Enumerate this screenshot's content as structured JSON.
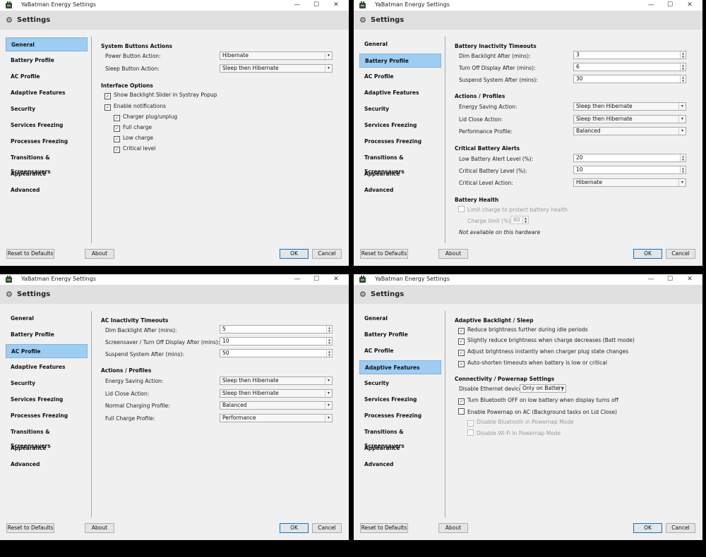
{
  "app_title": "YaBatman Energy Settings",
  "header_title": "Settings",
  "controls": {
    "minimize": "—",
    "maximize": "☐",
    "close": "✕"
  },
  "nav": [
    "General",
    "Battery Profile",
    "AC Profile",
    "Adaptive Features",
    "Security",
    "Services Freezing",
    "Processes Freezing",
    "Transitions & Screensavers",
    "Appearance",
    "Advanced"
  ],
  "buttons": {
    "reset": "Reset to Defaults",
    "about": "About",
    "ok": "OK",
    "cancel": "Cancel"
  },
  "colors": {
    "nav_active": "#9dcdf3",
    "header_bg": "#e0e0e0",
    "window_bg": "#f0f0f0"
  },
  "windows": [
    {
      "active_nav": "General",
      "general": {
        "system_buttons_title": "System Buttons Actions",
        "power_label": "Power Button Action:",
        "power_value": "Hibernate",
        "sleep_label": "Sleep Button Action:",
        "sleep_value": "Sleep then Hibernate",
        "interface_title": "Interface Options",
        "show_backlight": "Show Backlight Slider in Systray Popup",
        "enable_notifications": "Enable notifications",
        "charger_plug": "Charger plug/unplug",
        "full_charge": "Full charge",
        "low_charge": "Low charge",
        "critical_level": "Critical level"
      }
    },
    {
      "active_nav": "Battery Profile",
      "battery": {
        "timeouts_title": "Battery Inactivity Timeouts",
        "dim_label": "Dim Backlight After (mins):",
        "dim_value": "3",
        "off_label": "Turn Off Display After (mins):",
        "off_value": "6",
        "suspend_label": "Suspend System After (mins):",
        "suspend_value": "30",
        "actions_title": "Actions / Profiles",
        "energy_label": "Energy Saving Action:",
        "energy_value": "Sleep then Hibernate",
        "lid_label": "Lid Close Action:",
        "lid_value": "Sleep then Hibernate",
        "perf_label": "Performance Profile:",
        "perf_value": "Balanced",
        "alerts_title": "Critical Battery Alerts",
        "low_alert_label": "Low Battery Alert Level (%):",
        "low_alert_value": "20",
        "critical_label": "Critical Battery Level (%):",
        "critical_value": "10",
        "critical_action_label": "Critical Level Action:",
        "critical_action_value": "Hibernate",
        "health_title": "Battery Health",
        "limit_charge": "Limit charge to protect battery health",
        "charge_limit_label": "Charge limit (%):",
        "charge_limit_value": "60",
        "not_available": "Not available on this hardware"
      }
    },
    {
      "active_nav": "AC Profile",
      "ac": {
        "timeouts_title": "AC Inactivity Timeouts",
        "dim_label": "Dim Backlight After (mins):",
        "dim_value": "5",
        "screensaver_label": "Screensaver / Turn Off Display After (mins):",
        "screensaver_value": "10",
        "suspend_label": "Suspend System After (mins):",
        "suspend_value": "50",
        "actions_title": "Actions / Profiles",
        "energy_label": "Energy Saving Action:",
        "energy_value": "Sleep then Hibernate",
        "lid_label": "Lid Close Action:",
        "lid_value": "Sleep then Hibernate",
        "normal_label": "Normal Charging Profile:",
        "normal_value": "Balanced",
        "full_label": "Full Charge Profile:",
        "full_value": "Performance"
      }
    },
    {
      "active_nav": "Adaptive Features",
      "adaptive": {
        "backlight_title": "Adaptive Backlight / Sleep",
        "reduce_idle": "Reduce brightness further during idle periods",
        "reduce_charge": "Slightly reduce brightness when charge decreases (Batt mode)",
        "adjust_instantly": "Adjust brightness instantly when charger plug state changes",
        "auto_shorten": "Auto-shorten timeouts when battery is low or critical",
        "connectivity_title": "Connectivity / Powernap Settings",
        "ethernet_label": "Disable Ethernet device:",
        "ethernet_value": "Only on Battery",
        "bt_off": "Turn Bluetooth OFF on low battery when display turns off",
        "powernap": "Enable Powernap on AC (Background tasks on Lid Close)",
        "disable_bt": "Disable Bluetooth in Powernap Mode",
        "disable_wifi": "Disable Wi-Fi in Powernap Mode"
      }
    }
  ]
}
